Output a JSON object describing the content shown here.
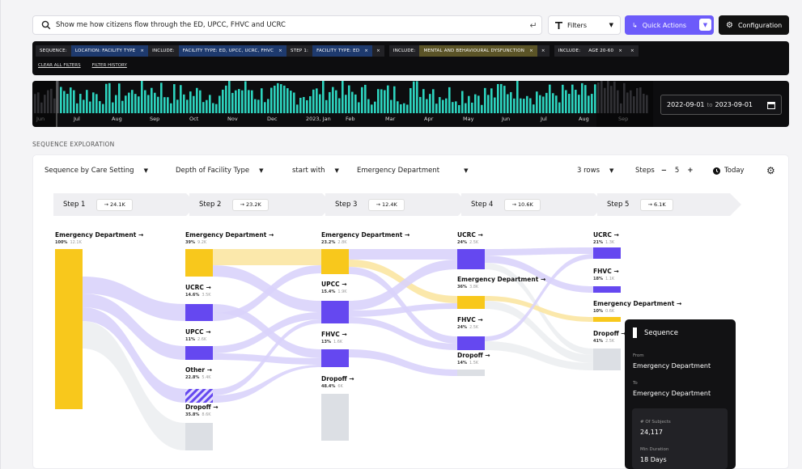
{
  "search": {
    "query": "Show me how citizens flow through the ED, UPCC, FHVC and UCRC"
  },
  "toolbar": {
    "filters_label": "Filters",
    "quick_actions_label": "Quick Actions",
    "configuration_label": "Configuration"
  },
  "filter_chips": [
    {
      "text": "SEQUENCE:",
      "style": "k"
    },
    {
      "text": "LOCATION: FACILITY TYPE",
      "style": "b",
      "x": true
    },
    {
      "text": "INCLUDE:",
      "style": "k"
    },
    {
      "text": "FACILITY TYPE: ED, UPCC, UCRC, FHVC",
      "style": "b",
      "x": true
    },
    {
      "text": "STEP 1:",
      "style": "k"
    },
    {
      "text": "FACILITY TYPE: ED",
      "style": "b",
      "x": true
    },
    {
      "text": "×",
      "style": "k"
    },
    {
      "text": "INCLUDE:",
      "style": "k"
    },
    {
      "text": "MENTAL AND BEHAVIOURAL DYSFUNCTION",
      "style": "g",
      "x": true
    },
    {
      "text": "×",
      "style": "k"
    },
    {
      "text": "INCLUDE:",
      "style": "k"
    },
    {
      "text": "AGE 20-60",
      "style": "k",
      "x": true
    },
    {
      "text": "×",
      "style": "k"
    }
  ],
  "filter_links": {
    "clear": "CLEAR ALL FILTERS",
    "history": "FILTER HISTORY"
  },
  "timeline": {
    "months": [
      "Jun",
      "Jul",
      "Aug",
      "Sep",
      "Oct",
      "Nov",
      "Dec",
      "2023, Jan",
      "Feb",
      "Mar",
      "Apr",
      "May",
      "Jun",
      "Jul",
      "Aug",
      "Sep"
    ],
    "start_date": "2022-09-01",
    "end_date": "2023-09-01",
    "to_label": "to",
    "accent": "#2dd4bf"
  },
  "section_label": "SEQUENCE EXPLORATION",
  "controls": {
    "sequence_by": "Sequence by Care Setting",
    "depth": "Depth of Facility Type",
    "start_mode": "start with",
    "start_value": "Emergency Department",
    "rows": "3 rows",
    "steps_label": "Steps",
    "steps_minus": "−",
    "steps_value": "5",
    "steps_plus": "+",
    "today": "Today"
  },
  "steps": [
    {
      "label": "Step 1",
      "count": "→ 24.1K"
    },
    {
      "label": "Step 2",
      "count": "→ 23.2K"
    },
    {
      "label": "Step 3",
      "count": "→ 12.4K"
    },
    {
      "label": "Step 4",
      "count": "→ 10.6K"
    },
    {
      "label": "Step 5",
      "count": "→ 6.1K"
    }
  ],
  "colors": {
    "ed": "#f8c81c",
    "ed_flow": "#fbe6a2",
    "ucrc": "#6548f0",
    "flow": "#d9d3fb",
    "other": "#c7c7ce",
    "grey": "#dcdfe4"
  },
  "nodes": [
    {
      "name": "Emergency Department",
      "pct": "100%",
      "n": "12.1K"
    },
    {
      "name": "Emergency Department",
      "pct": "39%",
      "n": "9.2K"
    },
    {
      "name": "UCRC",
      "pct": "14.6%",
      "n": "3.5K"
    },
    {
      "name": "UPCC",
      "pct": "11%",
      "n": "2.6K"
    },
    {
      "name": "Other",
      "pct": "22.8%",
      "n": "5.4K"
    },
    {
      "name": "Dropoff",
      "pct": "35.8%",
      "n": "8.6K"
    },
    {
      "name": "Emergency Department",
      "pct": "23.2%",
      "n": "2.8K"
    },
    {
      "name": "UPCC",
      "pct": "15.4%",
      "n": "1.9K"
    },
    {
      "name": "FHVC",
      "pct": "13%",
      "n": "1.6K"
    },
    {
      "name": "Dropoff",
      "pct": "48.4%",
      "n": "6K"
    },
    {
      "name": "UCRC",
      "pct": "24%",
      "n": "2.5K"
    },
    {
      "name": "Emergency Department",
      "pct": "36%",
      "n": "3.8K"
    },
    {
      "name": "FHVC",
      "pct": "24%",
      "n": "2.5K"
    },
    {
      "name": "Dropoff",
      "pct": "14%",
      "n": "1.5K"
    },
    {
      "name": "UCRC",
      "pct": "21%",
      "n": "1.3K"
    },
    {
      "name": "FHVC",
      "pct": "18%",
      "n": "1.1K"
    },
    {
      "name": "Emergency Department",
      "pct": "10%",
      "n": "0.6K"
    },
    {
      "name": "Dropoff",
      "pct": "41%",
      "n": "2.5K"
    }
  ],
  "tooltip": {
    "title": "Sequence",
    "from_label": "From",
    "from_value": "Emergency Department",
    "to_label": "To",
    "to_value": "Emergency Department",
    "subjects_label": "# Of Subjects",
    "subjects_value": "24,117",
    "duration_label": "Min Duration",
    "duration_value": "18 Days"
  }
}
